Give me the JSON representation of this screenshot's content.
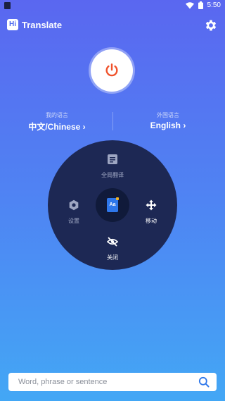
{
  "status_bar": {
    "time": "5:50"
  },
  "header": {
    "title": "Translate",
    "logo_text": "Hi"
  },
  "languages": {
    "source_caption": "我的语言",
    "source_value": "中文/Chinese ›",
    "target_caption": "外国语言",
    "target_value": "English ›"
  },
  "menu": {
    "center_text": "Aa",
    "top_label": "全局翻译",
    "left_label": "设置",
    "right_label": "移动",
    "bottom_label": "关闭"
  },
  "search": {
    "placeholder": "Word, phrase or sentence"
  },
  "colors": {
    "accent": "#2e77ea",
    "power": "#f0522b",
    "wheel": "#1d2854"
  }
}
